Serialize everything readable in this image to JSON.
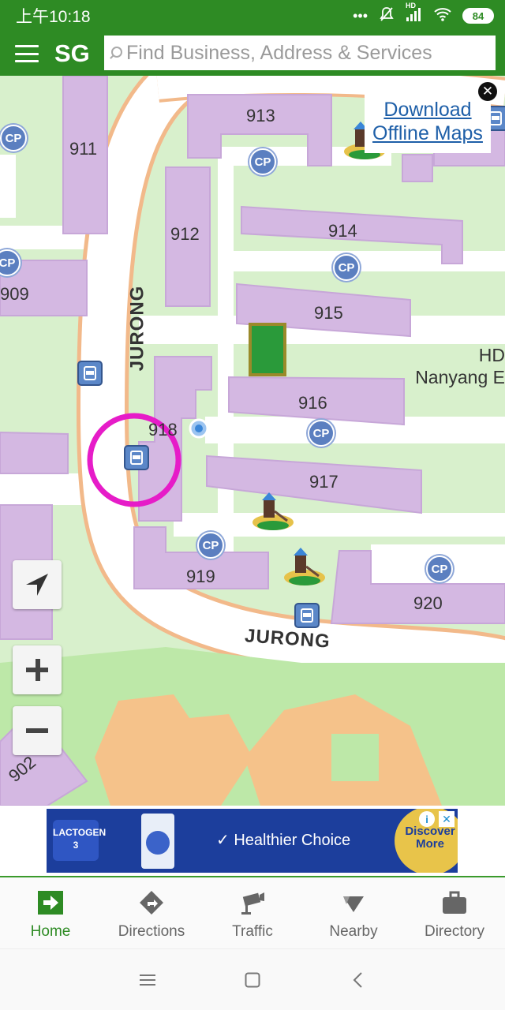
{
  "status_bar": {
    "time": "上午10:18",
    "signal_text": "HD",
    "battery": "84"
  },
  "app_bar": {
    "region": "SG",
    "search_placeholder": "Find Business, Address & Services"
  },
  "map": {
    "blocks": [
      "913",
      "911",
      "912",
      "914",
      "909",
      "915",
      "916",
      "918",
      "917",
      "919",
      "920",
      "902"
    ],
    "road_labels": [
      "JURONG",
      "JURONG"
    ],
    "carpark_label": "CP",
    "hdb_label_line1": "HD",
    "hdb_label_line2": "Nanyang E",
    "download_offline_maps_line1": "Download",
    "download_offline_maps_line2": "Offline Maps"
  },
  "ad": {
    "brand": "LACTOGEN 3",
    "headline": "✓ Healthier Choice",
    "cta": "Discover More",
    "info_icon": "i",
    "close_icon": "✕"
  },
  "bottom_nav": {
    "items": [
      {
        "label": "Home",
        "icon": "home-arrow-icon",
        "active": true
      },
      {
        "label": "Directions",
        "icon": "directions-icon",
        "active": false
      },
      {
        "label": "Traffic",
        "icon": "traffic-camera-icon",
        "active": false
      },
      {
        "label": "Nearby",
        "icon": "nearby-icon",
        "active": false
      },
      {
        "label": "Directory",
        "icon": "briefcase-icon",
        "active": false
      }
    ]
  },
  "colors": {
    "brand_green": "#2e8b24",
    "map_green": "#d8f0cc",
    "building_purple": "#d4b8e2",
    "road_white": "#ffffff",
    "highlight_magenta": "#e61cc8"
  }
}
